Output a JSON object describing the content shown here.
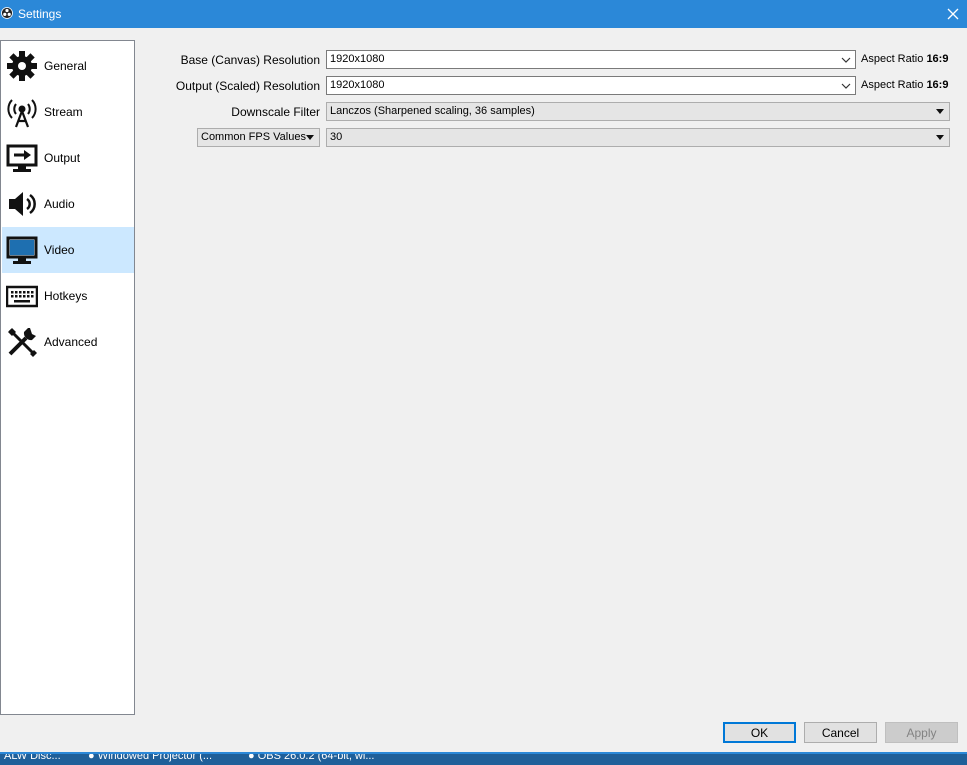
{
  "window": {
    "title": "Settings",
    "close_glyph": "✕",
    "app_icon": "obs-icon"
  },
  "sidebar": {
    "items": [
      {
        "label": "General",
        "icon": "gear-icon"
      },
      {
        "label": "Stream",
        "icon": "antenna-icon"
      },
      {
        "label": "Output",
        "icon": "output-monitor-icon"
      },
      {
        "label": "Audio",
        "icon": "speaker-icon"
      },
      {
        "label": "Video",
        "icon": "monitor-icon",
        "selected": true
      },
      {
        "label": "Hotkeys",
        "icon": "keyboard-icon"
      },
      {
        "label": "Advanced",
        "icon": "tools-icon"
      }
    ]
  },
  "video": {
    "base_label": "Base (Canvas) Resolution",
    "base_value": "1920x1080",
    "base_aspect_prefix": "Aspect Ratio",
    "base_aspect": "16:9",
    "output_label": "Output (Scaled) Resolution",
    "output_value": "1920x1080",
    "output_aspect_prefix": "Aspect Ratio",
    "output_aspect": "16:9",
    "downscale_label": "Downscale Filter",
    "downscale_value": "Lanczos (Sharpened scaling, 36 samples)",
    "fps_type": "Common FPS Values",
    "fps_value": "30"
  },
  "buttons": {
    "ok": "OK",
    "cancel": "Cancel",
    "apply": "Apply"
  },
  "taskbar": {
    "items": [
      "ALW Disc...",
      "Windowed Projector (...",
      "OBS 26.0.2 (64-bit, wi..."
    ]
  },
  "colors": {
    "accent": "#2b88d8",
    "selected": "#cce8ff"
  }
}
